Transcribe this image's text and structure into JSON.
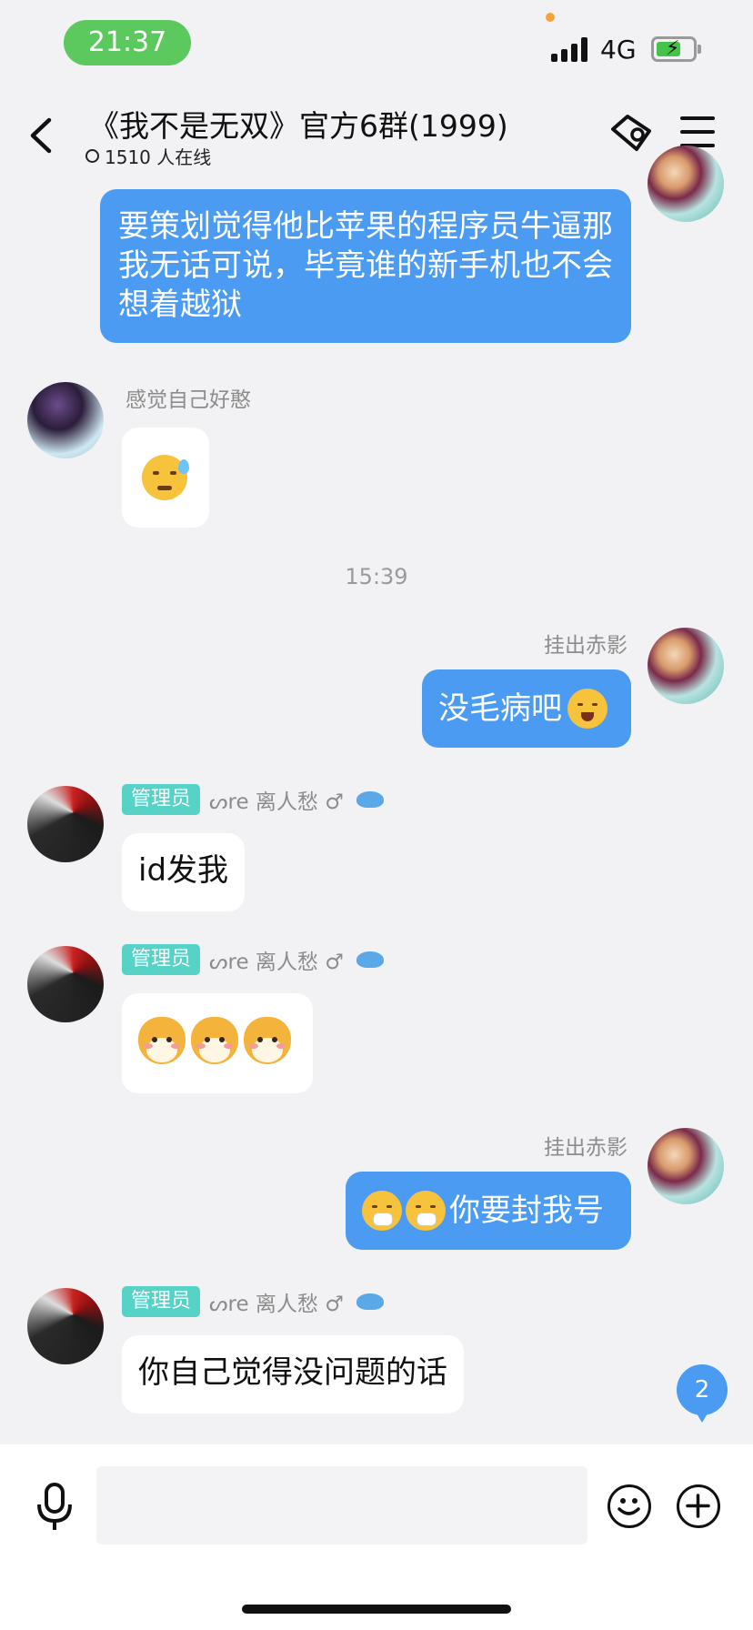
{
  "status_bar": {
    "time": "21:37",
    "network": "4G"
  },
  "header": {
    "title": "《我不是无双》官方6群(1999)",
    "online": "1510 人在线"
  },
  "messages": [
    {
      "id": "m1",
      "side": "me",
      "text": "要策划觉得他比苹果的程序员牛逼那我无话可说，毕竟谁的新手机也不会想着越狱"
    },
    {
      "id": "m2",
      "side": "other",
      "nickname": "感觉自己好憨",
      "content": "emoji"
    },
    {
      "id": "m3",
      "side": "me",
      "nickname": "挂出赤影",
      "text": "没毛病吧"
    },
    {
      "id": "m4",
      "side": "other",
      "role": "管理员",
      "nickname": "ᔕre 离人愁 ♂",
      "text": "id发我"
    },
    {
      "id": "m5",
      "side": "other",
      "role": "管理员",
      "nickname": "ᔕre 离人愁 ♂",
      "content": "shiba-stickers"
    },
    {
      "id": "m6",
      "side": "me",
      "nickname": "挂出赤影",
      "text": "你要封我号"
    },
    {
      "id": "m7",
      "side": "other",
      "role": "管理员",
      "nickname": "ᔕre 离人愁 ♂",
      "text": "你自己觉得没问题的话"
    }
  ],
  "timestamp": "15:39",
  "unread_count": "2",
  "input": {
    "placeholder": ""
  },
  "colors": {
    "my_bubble": "#4a9bf1",
    "admin_badge": "#56d2c6",
    "time_pill": "#5cc95e"
  },
  "icons": [
    "back-icon",
    "ticket-icon",
    "menu-icon",
    "mic-icon",
    "smiley-icon",
    "plus-icon"
  ]
}
